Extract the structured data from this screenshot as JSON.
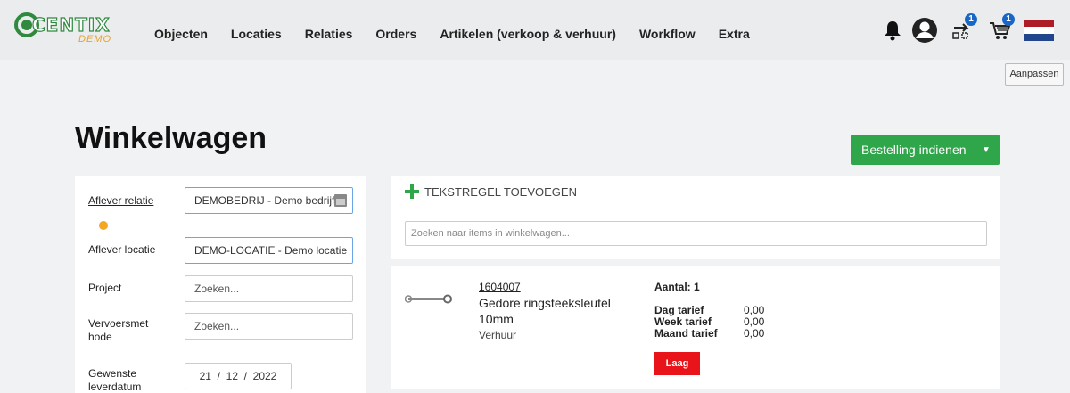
{
  "header": {
    "logo_text": "CENTIX",
    "logo_sub": "DEMO",
    "nav": [
      "Objecten",
      "Locaties",
      "Relaties",
      "Orders",
      "Artikelen (verkoop & verhuur)",
      "Workflow",
      "Extra"
    ],
    "icons": {
      "bell": "bell-icon",
      "user": "user-icon",
      "transfer": "transfer-icon",
      "cart": "cart-icon",
      "flag": "flag-nl-icon"
    },
    "transfer_badge": "1",
    "cart_badge": "1"
  },
  "aanpassen_label": "Aanpassen",
  "page_title": "Winkelwagen",
  "submit_button": "Bestelling indienen",
  "form": {
    "aflever_relatie": {
      "label": "Aflever relatie",
      "value": "DEMOBEDRIJ - Demo bedrijf"
    },
    "aflever_locatie": {
      "label": "Aflever locatie",
      "value": "DEMO-LOCATIE - Demo locatie"
    },
    "project": {
      "label": "Project",
      "placeholder": "Zoeken..."
    },
    "vervoersmethode": {
      "label": "Vervoersmethode",
      "placeholder": "Zoeken..."
    },
    "leverdatum": {
      "label": "Gewenste leverdatum",
      "value": "21  /  12  /  2022"
    }
  },
  "cart": {
    "add_text_line": "TEKSTREGEL TOEVOEGEN",
    "search_placeholder": "Zoeken naar items in winkelwagen...",
    "item": {
      "code": "1604007",
      "name": "Gedore ringsteeksleutel 10mm",
      "type": "Verhuur",
      "aantal": "Aantal: 1",
      "tarieven": [
        {
          "label": "Dag tarief",
          "value": "0,00"
        },
        {
          "label": "Week tarief",
          "value": "0,00"
        },
        {
          "label": "Maand tarief",
          "value": "0,00"
        }
      ],
      "priority": "Laag"
    }
  },
  "colors": {
    "accent_green": "#2fa64a",
    "badge_blue": "#1a66c6",
    "priority_red": "#e8141a",
    "warning_orange": "#f5a623"
  }
}
